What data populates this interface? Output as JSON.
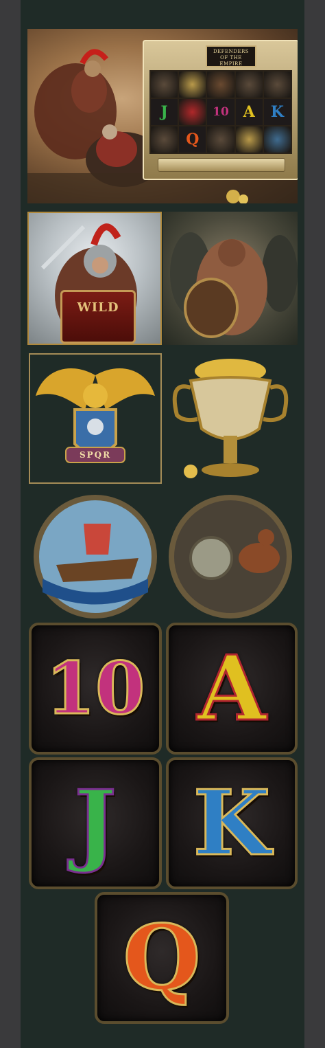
{
  "game": {
    "logo_text": "DEFENDERS\nOF THE\nEMPIRE",
    "wild_label": "WILD",
    "crest_banner": "SPQR"
  },
  "reel_symbols": [
    [
      "barbarian",
      "urn",
      "chariot",
      "barbarian",
      "barbarian"
    ],
    [
      "J",
      "eagle",
      "10",
      "A",
      "K"
    ],
    [
      "barbarian",
      "Q",
      "barbarian",
      "urn",
      "ship"
    ]
  ],
  "card_symbols": [
    {
      "text": "10",
      "color": "#c2327d",
      "edge": "#d9b85a"
    },
    {
      "text": "A",
      "color": "#e0c020",
      "edge": "#b1262f"
    },
    {
      "text": "J",
      "color": "#39b34a",
      "edge": "#7a2f8f"
    },
    {
      "text": "K",
      "color": "#2f7fc4",
      "edge": "#d9b85a"
    },
    {
      "text": "Q",
      "color": "#e4571c",
      "edge": "#d9b85a"
    }
  ],
  "colors": {
    "background": "#1f2b27",
    "outer": "#3a3a3c",
    "gold": "#c9a24a",
    "wild_red": "#7b1c14"
  }
}
